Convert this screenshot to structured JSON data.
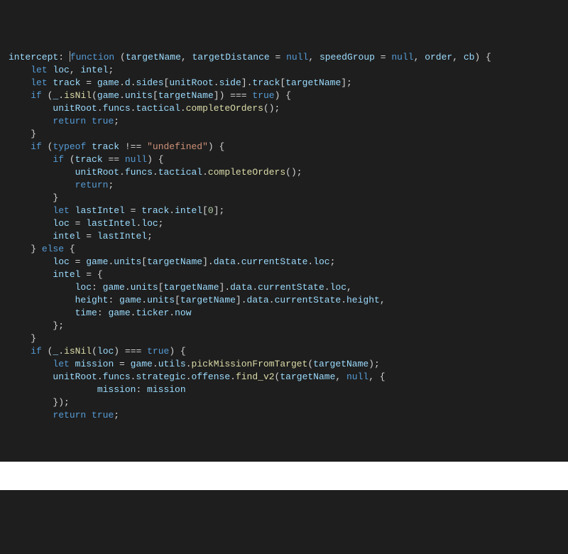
{
  "code": {
    "lines": [
      {
        "indent": 0,
        "tokens": [
          [
            "ident",
            "intercept"
          ],
          [
            "pun",
            ": "
          ],
          [
            "cursor",
            ""
          ],
          [
            "kw",
            "function"
          ],
          [
            "pun",
            " ("
          ],
          [
            "ident",
            "targetName"
          ],
          [
            "pun",
            ", "
          ],
          [
            "ident",
            "targetDistance"
          ],
          [
            "pun",
            " = "
          ],
          [
            "kw",
            "null"
          ],
          [
            "pun",
            ", "
          ],
          [
            "ident",
            "speedGroup"
          ],
          [
            "pun",
            " = "
          ],
          [
            "kw",
            "null"
          ],
          [
            "pun",
            ", "
          ],
          [
            "ident",
            "order"
          ],
          [
            "pun",
            ", "
          ],
          [
            "ident",
            "cb"
          ],
          [
            "pun",
            ") {"
          ]
        ]
      },
      {
        "indent": 1,
        "tokens": [
          [
            "kw",
            "let"
          ],
          [
            "pun",
            " "
          ],
          [
            "ident",
            "loc"
          ],
          [
            "pun",
            ", "
          ],
          [
            "ident",
            "intel"
          ],
          [
            "pun",
            ";"
          ]
        ]
      },
      {
        "indent": 1,
        "tokens": [
          [
            "kw",
            "let"
          ],
          [
            "pun",
            " "
          ],
          [
            "ident",
            "track"
          ],
          [
            "pun",
            " = "
          ],
          [
            "ident",
            "game"
          ],
          [
            "pun",
            "."
          ],
          [
            "ident",
            "d"
          ],
          [
            "pun",
            "."
          ],
          [
            "ident",
            "sides"
          ],
          [
            "pun",
            "["
          ],
          [
            "ident",
            "unitRoot"
          ],
          [
            "pun",
            "."
          ],
          [
            "ident",
            "side"
          ],
          [
            "pun",
            "]."
          ],
          [
            "ident",
            "track"
          ],
          [
            "pun",
            "["
          ],
          [
            "ident",
            "targetName"
          ],
          [
            "pun",
            "];"
          ]
        ]
      },
      {
        "indent": 1,
        "tokens": [
          [
            "kw",
            "if"
          ],
          [
            "pun",
            " ("
          ],
          [
            "ident",
            "_"
          ],
          [
            "pun",
            "."
          ],
          [
            "fn",
            "isNil"
          ],
          [
            "pun",
            "("
          ],
          [
            "ident",
            "game"
          ],
          [
            "pun",
            "."
          ],
          [
            "ident",
            "units"
          ],
          [
            "pun",
            "["
          ],
          [
            "ident",
            "targetName"
          ],
          [
            "pun",
            "]) === "
          ],
          [
            "kw",
            "true"
          ],
          [
            "pun",
            ") {"
          ]
        ]
      },
      {
        "indent": 2,
        "tokens": [
          [
            "ident",
            "unitRoot"
          ],
          [
            "pun",
            "."
          ],
          [
            "ident",
            "funcs"
          ],
          [
            "pun",
            "."
          ],
          [
            "ident",
            "tactical"
          ],
          [
            "pun",
            "."
          ],
          [
            "fn",
            "completeOrders"
          ],
          [
            "pun",
            "();"
          ]
        ]
      },
      {
        "indent": 2,
        "tokens": [
          [
            "kw",
            "return"
          ],
          [
            "pun",
            " "
          ],
          [
            "kw",
            "true"
          ],
          [
            "pun",
            ";"
          ]
        ]
      },
      {
        "indent": 1,
        "tokens": [
          [
            "pun",
            "}"
          ]
        ]
      },
      {
        "indent": 1,
        "tokens": [
          [
            "kw",
            "if"
          ],
          [
            "pun",
            " ("
          ],
          [
            "kw",
            "typeof"
          ],
          [
            "pun",
            " "
          ],
          [
            "ident",
            "track"
          ],
          [
            "pun",
            " !== "
          ],
          [
            "str",
            "\"undefined\""
          ],
          [
            "pun",
            ") {"
          ]
        ]
      },
      {
        "indent": 2,
        "tokens": [
          [
            "kw",
            "if"
          ],
          [
            "pun",
            " ("
          ],
          [
            "ident",
            "track"
          ],
          [
            "pun",
            " == "
          ],
          [
            "kw",
            "null"
          ],
          [
            "pun",
            ") {"
          ]
        ]
      },
      {
        "indent": 3,
        "tokens": [
          [
            "ident",
            "unitRoot"
          ],
          [
            "pun",
            "."
          ],
          [
            "ident",
            "funcs"
          ],
          [
            "pun",
            "."
          ],
          [
            "ident",
            "tactical"
          ],
          [
            "pun",
            "."
          ],
          [
            "fn",
            "completeOrders"
          ],
          [
            "pun",
            "();"
          ]
        ]
      },
      {
        "indent": 3,
        "tokens": [
          [
            "kw",
            "return"
          ],
          [
            "pun",
            ";"
          ]
        ]
      },
      {
        "indent": 2,
        "tokens": [
          [
            "pun",
            "}"
          ]
        ]
      },
      {
        "indent": 2,
        "tokens": [
          [
            "kw",
            "let"
          ],
          [
            "pun",
            " "
          ],
          [
            "ident",
            "lastIntel"
          ],
          [
            "pun",
            " = "
          ],
          [
            "ident",
            "track"
          ],
          [
            "pun",
            "."
          ],
          [
            "ident",
            "intel"
          ],
          [
            "pun",
            "["
          ],
          [
            "num",
            "0"
          ],
          [
            "pun",
            "];"
          ]
        ]
      },
      {
        "indent": 2,
        "tokens": [
          [
            "ident",
            "loc"
          ],
          [
            "pun",
            " = "
          ],
          [
            "ident",
            "lastIntel"
          ],
          [
            "pun",
            "."
          ],
          [
            "ident",
            "loc"
          ],
          [
            "pun",
            ";"
          ]
        ]
      },
      {
        "indent": 2,
        "tokens": [
          [
            "ident",
            "intel"
          ],
          [
            "pun",
            " = "
          ],
          [
            "ident",
            "lastIntel"
          ],
          [
            "pun",
            ";"
          ]
        ]
      },
      {
        "indent": 1,
        "tokens": [
          [
            "pun",
            "} "
          ],
          [
            "kw",
            "else"
          ],
          [
            "pun",
            " {"
          ]
        ]
      },
      {
        "indent": 2,
        "tokens": [
          [
            "ident",
            "loc"
          ],
          [
            "pun",
            " = "
          ],
          [
            "ident",
            "game"
          ],
          [
            "pun",
            "."
          ],
          [
            "ident",
            "units"
          ],
          [
            "pun",
            "["
          ],
          [
            "ident",
            "targetName"
          ],
          [
            "pun",
            "]."
          ],
          [
            "ident",
            "data"
          ],
          [
            "pun",
            "."
          ],
          [
            "ident",
            "currentState"
          ],
          [
            "pun",
            "."
          ],
          [
            "ident",
            "loc"
          ],
          [
            "pun",
            ";"
          ]
        ]
      },
      {
        "indent": 2,
        "tokens": [
          [
            "ident",
            "intel"
          ],
          [
            "pun",
            " = {"
          ]
        ]
      },
      {
        "indent": 3,
        "tokens": [
          [
            "ident",
            "loc"
          ],
          [
            "pun",
            ": "
          ],
          [
            "ident",
            "game"
          ],
          [
            "pun",
            "."
          ],
          [
            "ident",
            "units"
          ],
          [
            "pun",
            "["
          ],
          [
            "ident",
            "targetName"
          ],
          [
            "pun",
            "]."
          ],
          [
            "ident",
            "data"
          ],
          [
            "pun",
            "."
          ],
          [
            "ident",
            "currentState"
          ],
          [
            "pun",
            "."
          ],
          [
            "ident",
            "loc"
          ],
          [
            "pun",
            ","
          ]
        ]
      },
      {
        "indent": 3,
        "tokens": [
          [
            "ident",
            "height"
          ],
          [
            "pun",
            ": "
          ],
          [
            "ident",
            "game"
          ],
          [
            "pun",
            "."
          ],
          [
            "ident",
            "units"
          ],
          [
            "pun",
            "["
          ],
          [
            "ident",
            "targetName"
          ],
          [
            "pun",
            "]."
          ],
          [
            "ident",
            "data"
          ],
          [
            "pun",
            "."
          ],
          [
            "ident",
            "currentState"
          ],
          [
            "pun",
            "."
          ],
          [
            "ident",
            "height"
          ],
          [
            "pun",
            ","
          ]
        ]
      },
      {
        "indent": 3,
        "tokens": [
          [
            "ident",
            "time"
          ],
          [
            "pun",
            ": "
          ],
          [
            "ident",
            "game"
          ],
          [
            "pun",
            "."
          ],
          [
            "ident",
            "ticker"
          ],
          [
            "pun",
            "."
          ],
          [
            "ident",
            "now"
          ]
        ]
      },
      {
        "indent": 2,
        "tokens": [
          [
            "pun",
            "};"
          ]
        ]
      },
      {
        "indent": 1,
        "tokens": [
          [
            "pun",
            "}"
          ]
        ]
      },
      {
        "indent": 1,
        "tokens": [
          [
            "kw",
            "if"
          ],
          [
            "pun",
            " ("
          ],
          [
            "ident",
            "_"
          ],
          [
            "pun",
            "."
          ],
          [
            "fn",
            "isNil"
          ],
          [
            "pun",
            "("
          ],
          [
            "ident",
            "loc"
          ],
          [
            "pun",
            ") === "
          ],
          [
            "kw",
            "true"
          ],
          [
            "pun",
            ") {"
          ]
        ]
      },
      {
        "indent": 2,
        "tokens": [
          [
            "kw",
            "let"
          ],
          [
            "pun",
            " "
          ],
          [
            "ident",
            "mission"
          ],
          [
            "pun",
            " = "
          ],
          [
            "ident",
            "game"
          ],
          [
            "pun",
            "."
          ],
          [
            "ident",
            "utils"
          ],
          [
            "pun",
            "."
          ],
          [
            "fn",
            "pickMissionFromTarget"
          ],
          [
            "pun",
            "("
          ],
          [
            "ident",
            "targetName"
          ],
          [
            "pun",
            ");"
          ]
        ]
      },
      {
        "indent": 2,
        "tokens": [
          [
            "ident",
            "unitRoot"
          ],
          [
            "pun",
            "."
          ],
          [
            "ident",
            "funcs"
          ],
          [
            "pun",
            "."
          ],
          [
            "ident",
            "strategic"
          ],
          [
            "pun",
            "."
          ],
          [
            "ident",
            "offense"
          ],
          [
            "pun",
            "."
          ],
          [
            "fn",
            "find_v2"
          ],
          [
            "pun",
            "("
          ],
          [
            "ident",
            "targetName"
          ],
          [
            "pun",
            ", "
          ],
          [
            "kw",
            "null"
          ],
          [
            "pun",
            ", {"
          ]
        ]
      },
      {
        "indent": 4,
        "tokens": [
          [
            "ident",
            "mission"
          ],
          [
            "pun",
            ": "
          ],
          [
            "ident",
            "mission"
          ]
        ]
      },
      {
        "indent": 2,
        "tokens": [
          [
            "pun",
            "});"
          ]
        ]
      },
      {
        "indent": 2,
        "tokens": [
          [
            "kw",
            "return"
          ],
          [
            "pun",
            " "
          ],
          [
            "kw",
            "true"
          ],
          [
            "pun",
            ";"
          ]
        ]
      }
    ],
    "indent_unit": "    "
  }
}
